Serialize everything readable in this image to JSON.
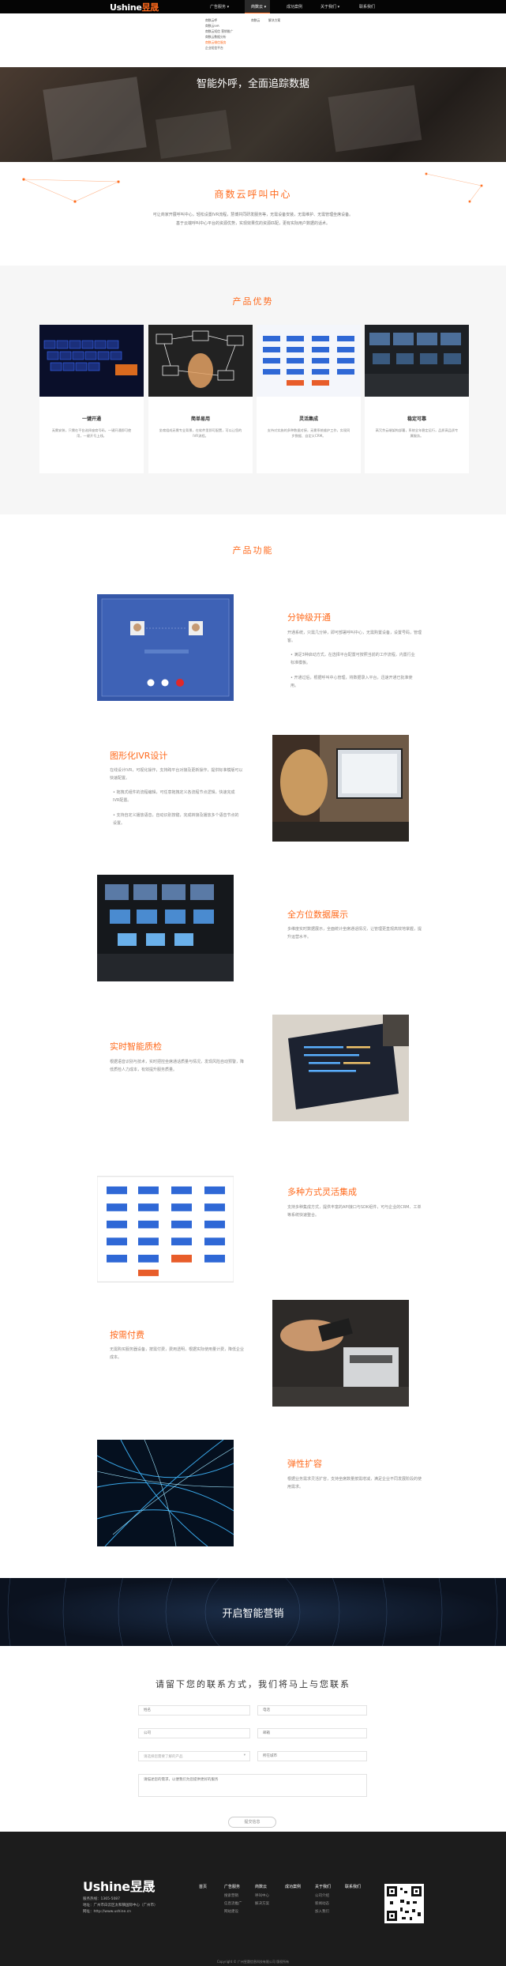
{
  "nav": {
    "logo_main": "Ushine",
    "logo_cn": "昱晟",
    "items": [
      "广告服务 ▾",
      "商数云 ▾",
      "成功案例",
      "关于我们 ▾",
      "联系我们"
    ]
  },
  "dropdowns": {
    "col1": [
      "商数云呼",
      "商数云IVR",
      "商数云短信 营销推广",
      "商数云数据分析",
      "商数云微信服务",
      "企业短信平台"
    ],
    "col2": [
      "商数云",
      "解决方案"
    ]
  },
  "hero": {
    "title": "智能外呼，全面追踪数据"
  },
  "intro": {
    "title": "商数云呼叫中心",
    "desc": [
      "可让商家开展呼叫中心，轻松设置IVR流程，慧博共同研发服务等，无需设备安装，无需维护、无需管理坐席设备。",
      "基于云端呼叫中心平台的资源优势，实现效果优的资源匹配，更有实际用户数据的话术。"
    ]
  },
  "advantages": {
    "title": "产品优势",
    "cards": [
      {
        "name": "一键开通",
        "desc": [
          "无需安装，只需在平台选择座席号码，一键开通即可使用，一键开号上线。"
        ]
      },
      {
        "name": "简单易用",
        "desc": [
          "坐席组成无需专业背景，在软件里即可配置，可以让您的IVR流程。"
        ]
      },
      {
        "name": "灵活集成",
        "desc": [
          "支持对实施的多种数据对接，无需系统维护工作，实现同步数据、自定义CRM。"
        ]
      },
      {
        "name": "稳定可靠",
        "desc": [
          "高冗余云端架构部署，系统全年稳定运行，品质高品质专属服务。"
        ]
      }
    ]
  },
  "features": {
    "title": "产品功能",
    "items": [
      {
        "title": "分钟级开通",
        "desc": "开通系统，只需几分钟，即可部署呼叫中心，无需购置设备，设置号码，管理客。",
        "bullets": [
          "• 满足3种启动方式，在选择平台配置可按照当前的工作流程，内置行业标准模板。",
          "• 开通过后，根据呼叫中心管理，将数据录入平台，迅速开通已批准使用。"
        ]
      },
      {
        "title": "图形化IVR设计",
        "desc": "在线设计IVR，可视化操作，支持跨平台对接及更新操作，提供标准模版可以快速配置。",
        "bullets": [
          "• 拖拽式组件的流程编辑，可任意拖拽定义各流程节点逻辑，快速完成IVR配置。",
          "• 支持自定义播放语音，自动识别按键，完成转接及播放多个语音节点的设置。"
        ]
      },
      {
        "title": "全方位数据展示",
        "desc": "多维度实时数据展示，全面统计坐席通话情况，让管理更直观高效地掌握，提升运营水平。",
        "bullets": []
      },
      {
        "title": "实时智能质检",
        "desc": "根据语音识别与技术，实时把控坐席通话质量与情况，发现风险自动预警，降低质检人力成本，有效提升服务质量。",
        "bullets": []
      },
      {
        "title": "多种方式灵活集成",
        "desc": "支持多种集成方式，提供丰富的API接口与SDK组件，可与企业的CRM、工单等系统快速整合。",
        "bullets": []
      },
      {
        "title": "按需付费",
        "desc": "无需购买服务器设备，按需付费，费用透明，根据实际使用量计费，降低企业成本。",
        "bullets": []
      },
      {
        "title": "弹性扩容",
        "desc": "根据业务需求灵活扩容，支持坐席数量按需增减，满足企业不同发展阶段的使用需求。",
        "bullets": []
      }
    ]
  },
  "cta": {
    "title": "开启智能营销"
  },
  "contact": {
    "title": "请留下您的联系方式，我们将马上与您联系",
    "fields": {
      "name": "姓名",
      "phone": "电话",
      "company": "公司",
      "email": "邮箱",
      "product": "请选择您需要了解的产品",
      "address": "所在城市",
      "message": "请描述您的需求，以便我们为您提供更好的服务"
    },
    "submit": "提交信息"
  },
  "footer": {
    "logo_main": "Ushine",
    "logo_cn": "昱晟",
    "info": [
      "服务热线：1365-5087",
      "地址：广州市白云区太和镇国际中心（广州市）",
      "网址：http://www.ushine.cn"
    ],
    "columns": [
      {
        "head": "首页",
        "links": []
      },
      {
        "head": "广告服务",
        "links": [
          "搜索营销",
          "信息流推广",
          "网站建设"
        ]
      },
      {
        "head": "商数云",
        "links": [
          "呼叫中心",
          "解决方案"
        ]
      },
      {
        "head": "成功案例",
        "links": []
      },
      {
        "head": "关于我们",
        "links": [
          "公司介绍",
          "新闻动态",
          "加入我们"
        ]
      },
      {
        "head": "联系我们",
        "links": []
      }
    ],
    "copyright": "Copyright © 广州昱晟信息科技有限公司 版权所有"
  },
  "colors": {
    "accent": "#ff6a1c",
    "nav_bg": "#050505",
    "footer_bg": "#1c1c1c"
  }
}
